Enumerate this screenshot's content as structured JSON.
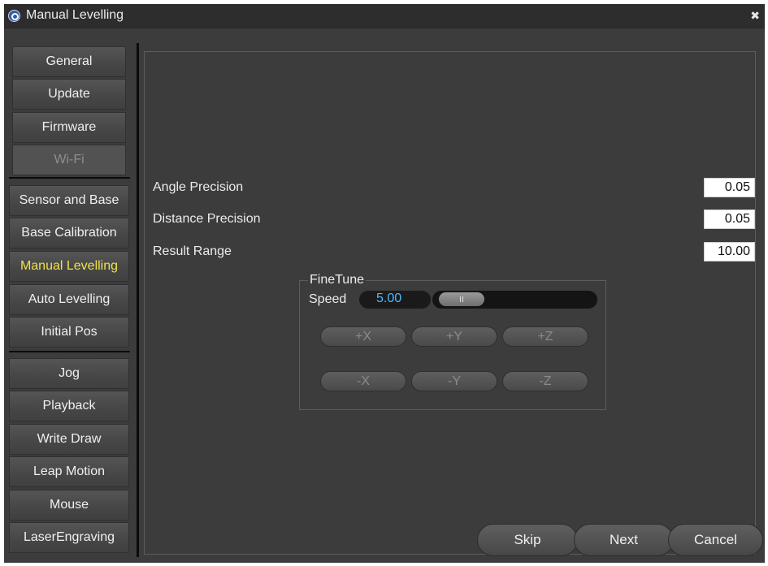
{
  "window": {
    "title": "Manual Levelling",
    "close_icon": "close-icon"
  },
  "sidebar": {
    "group1": [
      {
        "label": "General",
        "state": "normal"
      },
      {
        "label": "Update",
        "state": "normal"
      },
      {
        "label": "Firmware",
        "state": "normal"
      },
      {
        "label": "Wi-Fi",
        "state": "disabled"
      }
    ],
    "group2": [
      {
        "label": "Sensor and Base",
        "state": "normal"
      },
      {
        "label": "Base Calibration",
        "state": "normal"
      },
      {
        "label": "Manual Levelling",
        "state": "active"
      },
      {
        "label": "Auto Levelling",
        "state": "normal"
      },
      {
        "label": "Initial Pos",
        "state": "normal"
      }
    ],
    "group3": [
      {
        "label": "Jog",
        "state": "normal"
      },
      {
        "label": "Playback",
        "state": "normal"
      },
      {
        "label": "Write  Draw",
        "state": "normal"
      },
      {
        "label": "Leap Motion",
        "state": "normal"
      },
      {
        "label": "Mouse",
        "state": "normal"
      },
      {
        "label": "LaserEngraving",
        "state": "normal"
      }
    ]
  },
  "settings": [
    {
      "label": "Angle Precision",
      "value": "0.05"
    },
    {
      "label": "Distance Precision",
      "value": "0.05"
    },
    {
      "label": "Result Range",
      "value": "10.00"
    }
  ],
  "finetune": {
    "title": "FineTune",
    "speed_label": "Speed",
    "speed_value": "5.00",
    "slider_level": 0.1,
    "buttons_row1": [
      "+X",
      "+Y",
      "+Z"
    ],
    "buttons_row2": [
      "-X",
      "-Y",
      "-Z"
    ]
  },
  "nav": {
    "skip": "Skip",
    "next": "Next",
    "cancel": "Cancel"
  },
  "colors": {
    "active_item": "#f0e24a",
    "speed_value": "#4fb8ff",
    "background": "#3c3c3c"
  }
}
